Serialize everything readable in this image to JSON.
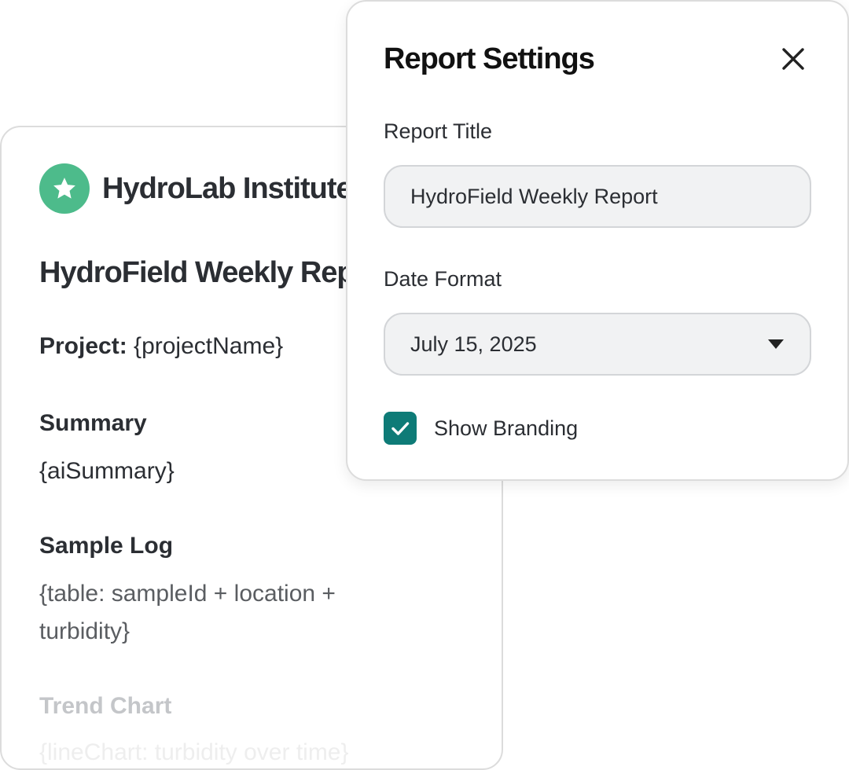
{
  "report_preview": {
    "brand_name": "HydroLab Institute",
    "title": "HydroField Weekly Report",
    "project_label": "Project:",
    "project_value": "{projectName}",
    "sections": [
      {
        "heading": "Summary",
        "body": "{aiSummary}"
      },
      {
        "heading": "Sample Log",
        "body": "{table: sampleId + location + turbidity}"
      },
      {
        "heading": "Trend Chart",
        "body": "{lineChart: turbidity over time}"
      }
    ]
  },
  "settings": {
    "title": "Report Settings",
    "report_title_label": "Report Title",
    "report_title_value": "HydroField Weekly Report",
    "date_format_label": "Date Format",
    "date_format_value": "July 15, 2025",
    "show_branding_label": "Show Branding",
    "show_branding_checked": true
  },
  "colors": {
    "brand_logo": "#4dbb8b",
    "checkbox_accent": "#0e7b77"
  },
  "icons": {
    "brand_logo": "star-icon",
    "close": "close-icon",
    "dropdown": "caret-down-icon",
    "checkbox": "check-icon"
  }
}
